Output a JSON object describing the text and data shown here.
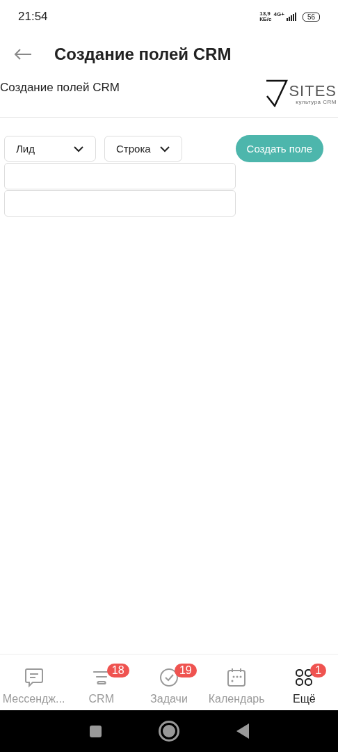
{
  "status_bar": {
    "time": "21:54",
    "speed": "13,9",
    "speed_unit": "КБ/с",
    "network": "4G+",
    "battery": "56"
  },
  "header": {
    "title": "Создание полей CRM"
  },
  "page": {
    "subtitle": "Создание полей CRM",
    "logo": {
      "word": "SITES",
      "tagline": "культура CRM"
    }
  },
  "form": {
    "selects": [
      {
        "value": "Лид"
      },
      {
        "value": "Строка"
      }
    ],
    "create_button": "Создать поле",
    "fields": [
      {
        "kind": "text"
      },
      {
        "kind": "text"
      }
    ]
  },
  "bottom_nav": [
    {
      "label": "Мессендж...",
      "kind": "chat",
      "selected": false
    },
    {
      "label": "CRM",
      "kind": "funnel",
      "badge": "18",
      "selected": false
    },
    {
      "label": "Задачи",
      "kind": "check",
      "badge": "19",
      "selected": false
    },
    {
      "label": "Календарь",
      "kind": "calendar",
      "selected": false
    },
    {
      "label": "Ещё",
      "kind": "grid",
      "badge": "1",
      "selected": true
    }
  ]
}
